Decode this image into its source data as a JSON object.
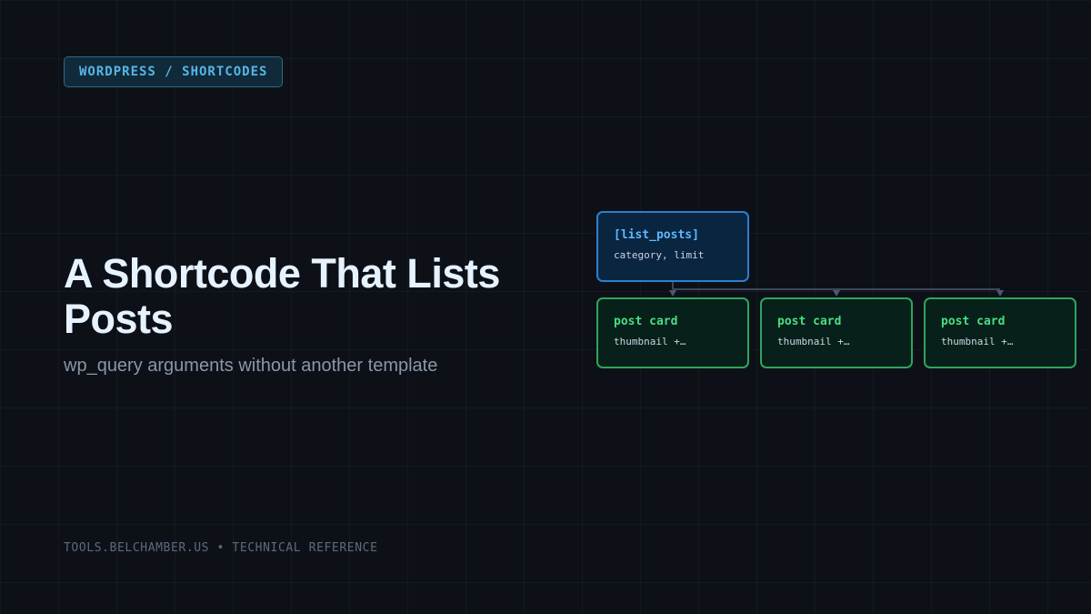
{
  "tag": "WORDPRESS / SHORTCODES",
  "title": "A Shortcode That Lists Posts",
  "subtitle": "wp_query arguments without another template",
  "footer": "TOOLS.BELCHAMBER.US • TECHNICAL REFERENCE",
  "diagram": {
    "root": {
      "label": "[list_posts]",
      "detail": "category, limit"
    },
    "children": [
      {
        "label": "post card",
        "detail": "thumbnail +…"
      },
      {
        "label": "post card",
        "detail": "thumbnail +…"
      },
      {
        "label": "post card",
        "detail": "thumbnail +…"
      }
    ]
  },
  "colors": {
    "background": "#0d1117",
    "accent_blue": "#5cb8ff",
    "accent_green": "#4ade80",
    "connector": "#4b5870"
  }
}
